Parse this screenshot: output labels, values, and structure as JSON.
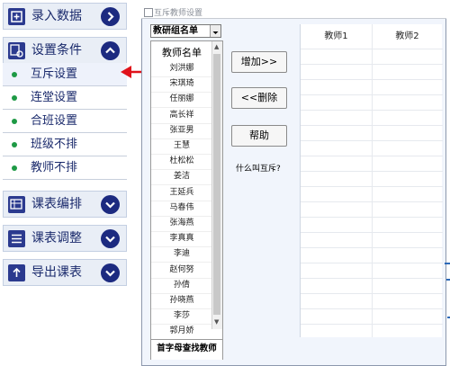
{
  "nav": {
    "enter_data": "录入数据",
    "settings": "设置条件",
    "settings_items": [
      "互斥设置",
      "连堂设置",
      "合班设置",
      "班级不排",
      "教师不排"
    ],
    "edit_schedule": "课表编排",
    "adjust_schedule": "课表调整",
    "export_schedule": "导出课表"
  },
  "dialog": {
    "title": "互斥教师设置",
    "group_combo": "教研组名单",
    "list_header": "教师名单",
    "teachers": [
      "刘洪娜",
      "宋琪琦",
      "任丽娜",
      "高长祥",
      "张亚男",
      "王慧",
      "杜松松",
      "姜洁",
      "王延兵",
      "马春伟",
      "张海燕",
      "李真真",
      "李迪",
      "赵何努",
      "孙倩",
      "孙晓燕",
      "李莎",
      "郭月娇"
    ],
    "search_label": "首字母查找教师",
    "add_button": "增加>>",
    "delete_button": "<<删除",
    "help_button": "帮助",
    "help_link": "什么叫互斥?",
    "grid_columns": [
      "教师1",
      "教师2"
    ]
  },
  "colors": {
    "nav_text": "#1a2a6c",
    "accent": "#1c2a80",
    "dot": "#1e9a45",
    "arrow": "#e0121a"
  }
}
